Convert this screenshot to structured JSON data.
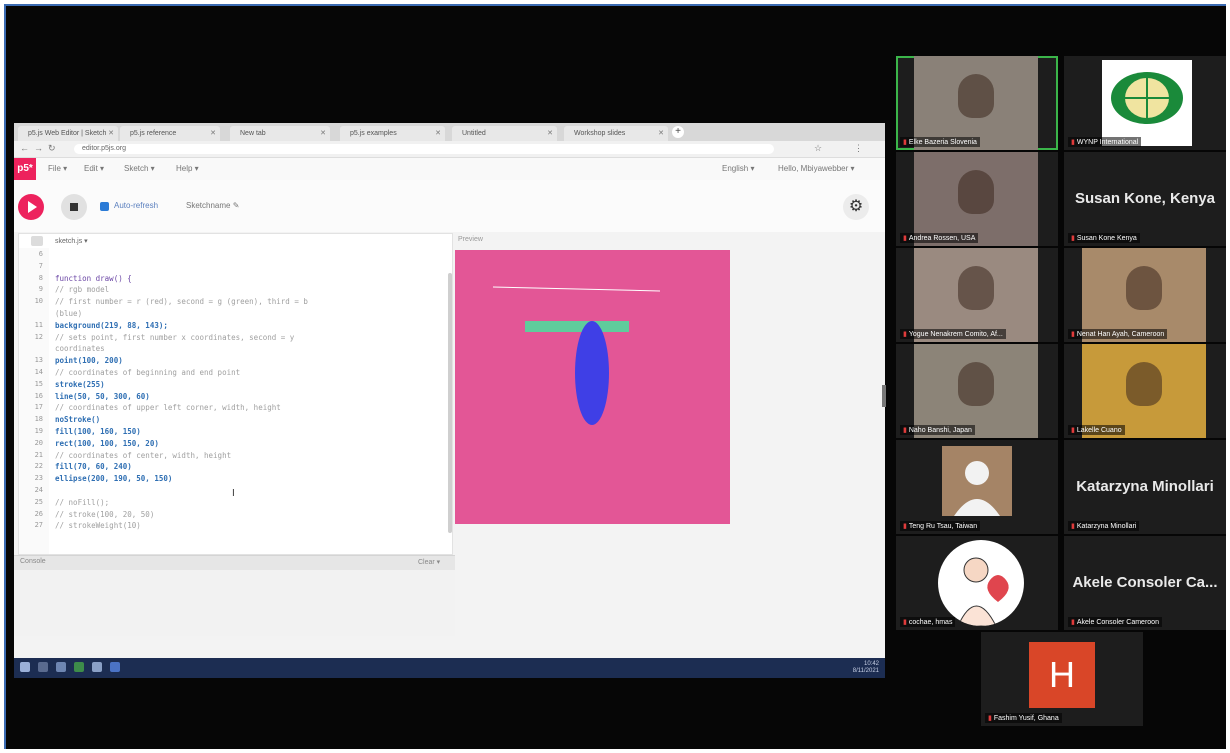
{
  "browser": {
    "tabs": [
      "p5.js Web Editor | Sketch",
      "p5.js reference",
      "New tab",
      "p5.js examples",
      "Untitled",
      "Workshop slides"
    ],
    "address": "editor.p5js.org"
  },
  "editor": {
    "logo": "p5*",
    "menus": [
      "File ▾",
      "Edit ▾",
      "Sketch ▾",
      "Help ▾"
    ],
    "right_menus": [
      "English ▾",
      "Hello, Mbiyawebber ▾"
    ],
    "auto_refresh_label": "Auto-refresh",
    "sketch_name": "Sketchname ✎",
    "file_tab": "sketch.js ▾",
    "console_label": "Console",
    "clear_label": "Clear ▾",
    "preview_label": "Preview",
    "code_lines": [
      {
        "n": "6",
        "t": "",
        "c": "tx"
      },
      {
        "n": "7",
        "t": "",
        "c": "tx"
      },
      {
        "n": "8",
        "t": "function draw() {",
        "c": "kw"
      },
      {
        "n": "9",
        "t": "  // rgb model",
        "c": "cm"
      },
      {
        "n": "10",
        "t": "  // first number = r (red), second = g (green), third = b",
        "c": "cm"
      },
      {
        "n": "",
        "t": "(blue)",
        "c": "cm"
      },
      {
        "n": "11",
        "t": "  background(219, 88, 143);",
        "c": "fn"
      },
      {
        "n": "12",
        "t": "  // sets point, first number x coordinates, second = y",
        "c": "cm"
      },
      {
        "n": "",
        "t": "coordinates",
        "c": "cm"
      },
      {
        "n": "13",
        "t": "  point(100, 200)",
        "c": "fn"
      },
      {
        "n": "14",
        "t": "  // coordinates of beginning and end point",
        "c": "cm"
      },
      {
        "n": "15",
        "t": "  stroke(255)",
        "c": "fn"
      },
      {
        "n": "16",
        "t": "  line(50, 50, 300, 60)",
        "c": "fn"
      },
      {
        "n": "17",
        "t": "  // coordinates of upper left corner, width, height",
        "c": "cm"
      },
      {
        "n": "18",
        "t": "  noStroke()",
        "c": "fn"
      },
      {
        "n": "19",
        "t": "  fill(100, 160, 150)",
        "c": "fn"
      },
      {
        "n": "20",
        "t": "  rect(100, 100, 150, 20)",
        "c": "fn"
      },
      {
        "n": "21",
        "t": "  // coordinates of center, width, height",
        "c": "cm"
      },
      {
        "n": "22",
        "t": "  fill(70, 60, 240)",
        "c": "fn"
      },
      {
        "n": "23",
        "t": "  ellipse(200, 190, 50, 150)",
        "c": "fn"
      },
      {
        "n": "24",
        "t": "",
        "c": "tx"
      },
      {
        "n": "25",
        "t": "  // noFill();",
        "c": "cm"
      },
      {
        "n": "26",
        "t": "  // stroke(100, 20, 50)",
        "c": "cm"
      },
      {
        "n": "27",
        "t": "  // strokeWeight(10)",
        "c": "cm"
      }
    ],
    "colors": {
      "accent": "#ed225d",
      "canvas_bg": "#e35696",
      "rect_fill": "#5fcc9c",
      "ellipse_fill": "#3f3fe6"
    }
  },
  "taskbar": {
    "time": "10:42",
    "date": "8/11/2021"
  },
  "participants": [
    {
      "name": "Elke Bazeria Slovenia",
      "big": "",
      "kind": "video",
      "active": true
    },
    {
      "name": "WYNP International",
      "big": "",
      "kind": "logo",
      "active": false
    },
    {
      "name": "Andrea Rossen, USA",
      "big": "",
      "kind": "video",
      "active": false
    },
    {
      "name": "Susan Kone Kenya",
      "big": "Susan Kone, Kenya",
      "kind": "name",
      "active": false
    },
    {
      "name": "Yogue Nenakrem Comito, Af...",
      "big": "",
      "kind": "video",
      "active": false
    },
    {
      "name": "Nenat Han Ayah, Cameroon",
      "big": "",
      "kind": "video",
      "active": false
    },
    {
      "name": "Naho Banshi, Japan",
      "big": "",
      "kind": "video",
      "active": false
    },
    {
      "name": "Lakelle Cuano",
      "big": "",
      "kind": "video",
      "active": false
    },
    {
      "name": "Teng Ru Tsau, Taiwan",
      "big": "",
      "kind": "avatar",
      "active": false
    },
    {
      "name": "Katarzyna Minollari",
      "big": "Katarzyna Minollari",
      "kind": "name",
      "active": false
    },
    {
      "name": "cochae, hmas",
      "big": "",
      "kind": "drawing",
      "active": false
    },
    {
      "name": "Akele Consoler Cameroon",
      "big": "Akele Consoler Ca...",
      "kind": "name",
      "active": false
    },
    {
      "name": "Fashim Yusif, Ghana",
      "big": "H",
      "kind": "initial",
      "active": false
    }
  ]
}
